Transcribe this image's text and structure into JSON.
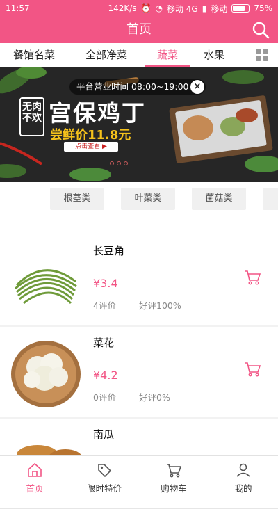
{
  "status_bar": {
    "time": "11:57",
    "network_speed": "142K/s",
    "carrier1": "移动 4G",
    "carrier2": "移动",
    "battery": "75%",
    "battery_level": 0.75
  },
  "header": {
    "title": "首页"
  },
  "tabs": [
    {
      "label": "餐馆名菜",
      "active": false
    },
    {
      "label": "全部净菜",
      "active": false
    },
    {
      "label": "蔬菜",
      "active": true
    },
    {
      "label": "水果",
      "active": false
    }
  ],
  "banner": {
    "hours": "平台营业时间 08:00~19:00",
    "close": "×",
    "badge": "无肉不欢",
    "dish": "宫保鸡丁",
    "price_label": "尝鲜价11.8元",
    "button": "点击查看 ▶"
  },
  "categories": [
    "根茎类",
    "叶菜类",
    "菌菇类"
  ],
  "products": [
    {
      "name": "长豆角",
      "price": "¥3.4",
      "reviews": "4评价",
      "rating": "好评100%"
    },
    {
      "name": "菜花",
      "price": "¥4.2",
      "reviews": "0评价",
      "rating": "好评0%"
    },
    {
      "name": "南瓜",
      "price": "",
      "reviews": "",
      "rating": ""
    }
  ],
  "bottom_nav": [
    {
      "label": "首页",
      "icon": "home-icon",
      "active": true
    },
    {
      "label": "限时特价",
      "icon": "tag-icon",
      "active": false
    },
    {
      "label": "购物车",
      "icon": "cart-icon",
      "active": false
    },
    {
      "label": "我的",
      "icon": "user-icon",
      "active": false
    }
  ],
  "colors": {
    "accent": "#f25585"
  }
}
